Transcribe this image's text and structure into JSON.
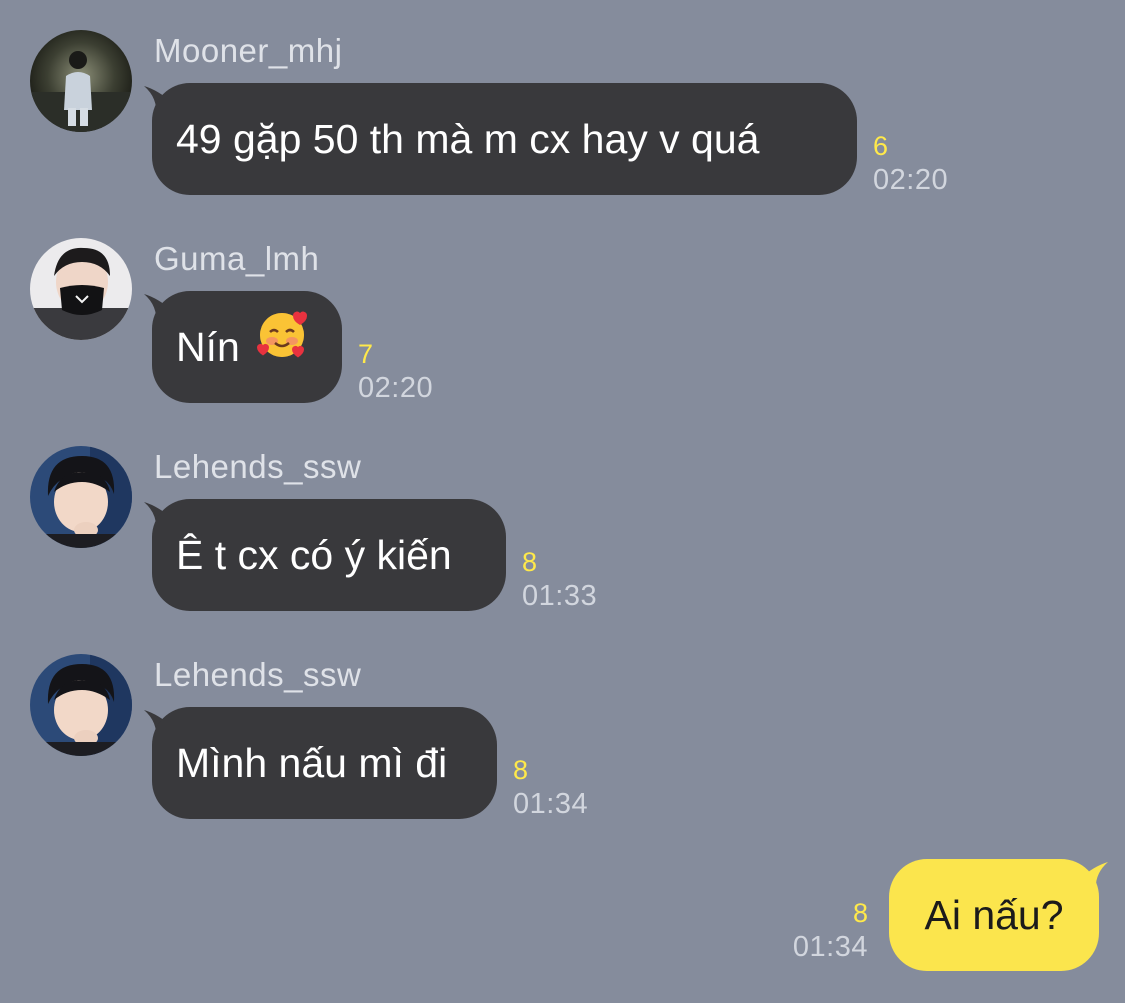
{
  "colors": {
    "background": "#858c9c",
    "incoming_bubble": "#39393c",
    "outgoing_bubble": "#fbe54d",
    "unread_count": "#ffe94a",
    "timestamp": "#d2d6de",
    "sender_name": "#dfe2e8"
  },
  "messages": [
    {
      "sender": "Mooner_mhj",
      "text": "49 gặp 50 th mà m cx hay v quá",
      "unread": "6",
      "time": "02:20",
      "avatar_icon": "profile-photo-icon"
    },
    {
      "sender": "Guma_lmh",
      "text": "Nín",
      "emoji_icon": "smiling-face-with-hearts-icon",
      "unread": "7",
      "time": "02:20",
      "avatar_icon": "profile-photo-icon"
    },
    {
      "sender": "Lehends_ssw",
      "text": "Ê t cx có ý kiến",
      "unread": "8",
      "time": "01:33",
      "avatar_icon": "profile-photo-icon"
    },
    {
      "sender": "Lehends_ssw",
      "text": "Mình nấu mì đi",
      "unread": "8",
      "time": "01:34",
      "avatar_icon": "profile-photo-icon"
    }
  ],
  "outgoing": {
    "text": "Ai nấu?",
    "unread": "8",
    "time": "01:34"
  }
}
